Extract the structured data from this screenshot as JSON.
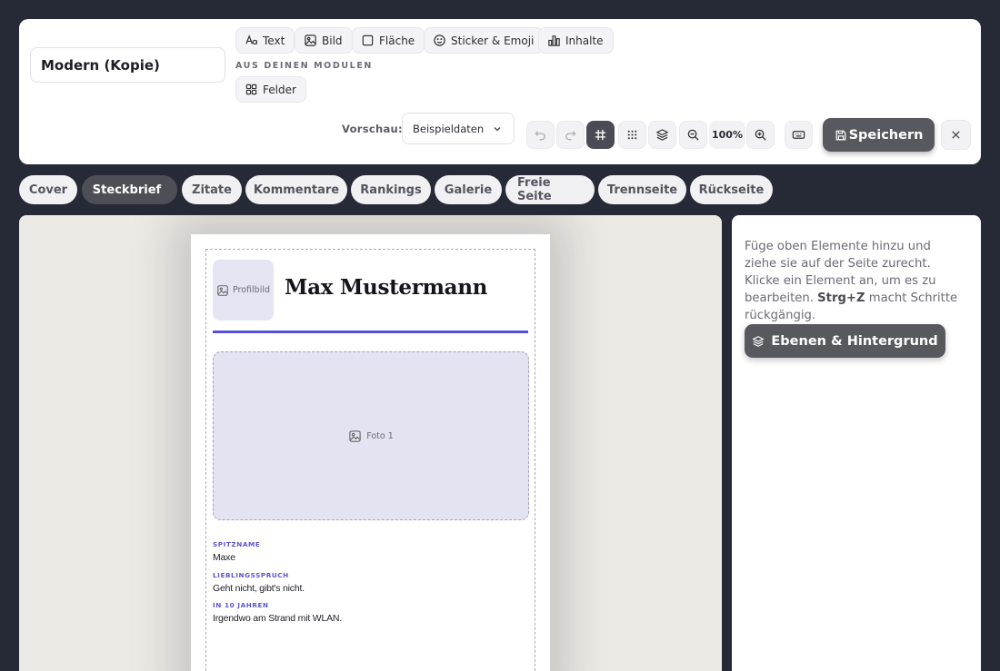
{
  "doc_title": "Modern (Kopie)",
  "toolbar": {
    "insert_buttons": [
      {
        "label": "Text",
        "icon": "text-icon"
      },
      {
        "label": "Bild",
        "icon": "image-icon"
      },
      {
        "label": "Fläche",
        "icon": "shape-icon"
      },
      {
        "label": "Sticker & Emoji",
        "icon": "smiley-icon"
      },
      {
        "label": "Inhalte",
        "icon": "chart-icon"
      }
    ],
    "modules_heading": "AUS DEINEN MODULEN",
    "module_buttons": [
      {
        "label": "Felder",
        "icon": "grid-icon"
      }
    ],
    "preview_label": "Vorschau:",
    "preview_value": "Beispieldaten",
    "zoom": "100%",
    "save_label": "Speichern"
  },
  "tabs": [
    {
      "label": "Cover",
      "active": false
    },
    {
      "label": "Steckbrief",
      "active": true
    },
    {
      "label": "Zitate",
      "active": false
    },
    {
      "label": "Kommentare",
      "active": false
    },
    {
      "label": "Rankings",
      "active": false
    },
    {
      "label": "Galerie",
      "active": false
    },
    {
      "label": "Freie Seite",
      "active": false
    },
    {
      "label": "Trennseite",
      "active": false
    },
    {
      "label": "Rückseite",
      "active": false
    }
  ],
  "page": {
    "avatar_label": "Profilbild",
    "name": "Max Mustermann",
    "photo_label": "Foto 1",
    "fields": [
      {
        "label": "SPITZNAME",
        "value": "Maxe"
      },
      {
        "label": "LIEBLINGSSPRUCH",
        "value": "Geht nicht, gibt's nicht."
      },
      {
        "label": "IN 10 JAHREN",
        "value": "Irgendwo am Strand mit WLAN."
      }
    ]
  },
  "sidebar": {
    "help_part1": "Füge oben Elemente hinzu und ziehe sie auf der Seite zurecht. Klicke ein Element an, um es zu bearbeiten. ",
    "help_shortcut": "Strg+Z",
    "help_part2": " macht Schritte rückgängig.",
    "layers_label": "Ebenen & Hintergrund"
  },
  "colors": {
    "accent": "#5550d8",
    "dark_button": "#58585f",
    "background": "#262936"
  }
}
